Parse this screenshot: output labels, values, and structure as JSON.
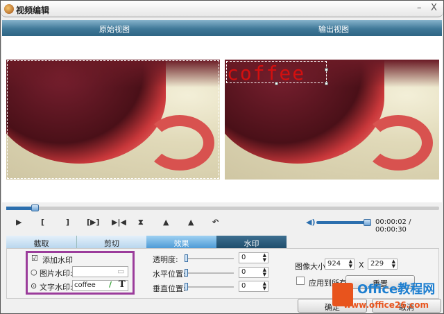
{
  "window": {
    "title": "视频编辑",
    "minimize": "–",
    "close": "X"
  },
  "preview": {
    "original_label": "原始视图",
    "output_label": "输出视图",
    "watermark_text": "coffee"
  },
  "player": {
    "progress_fraction": 0.067,
    "controls": [
      "▶",
      "[",
      "]",
      "[▶]",
      "▶|◀",
      "⧗",
      "▲",
      "▲",
      "↶"
    ],
    "volume_fraction": 1.0,
    "time": "00:00:02 / 00:00:30"
  },
  "tabs": [
    {
      "label": "截取"
    },
    {
      "label": "剪切"
    },
    {
      "label": "效果"
    },
    {
      "label": "水印"
    }
  ],
  "watermark": {
    "enable_label": "添加水印",
    "enabled": true,
    "image_label": "图片水印:",
    "image_value": "",
    "text_label": "文字水印:",
    "text_value": "coffee",
    "selected": "text",
    "text_tool": "T"
  },
  "adjust": {
    "opacity_label": "透明度:",
    "opacity": "0",
    "h_label": "水平位置:",
    "h": "0",
    "v_label": "垂直位置:",
    "v": "0"
  },
  "size": {
    "label": "图像大小:",
    "width": "924",
    "x": "X",
    "height": "229",
    "apply_all_label": "应用到所有",
    "reset_label": "重置"
  },
  "footer": {
    "ok_label": "确定",
    "cancel_label": "取消"
  },
  "brand": {
    "line1": "Office教程网",
    "line2": "www.office26.com"
  }
}
